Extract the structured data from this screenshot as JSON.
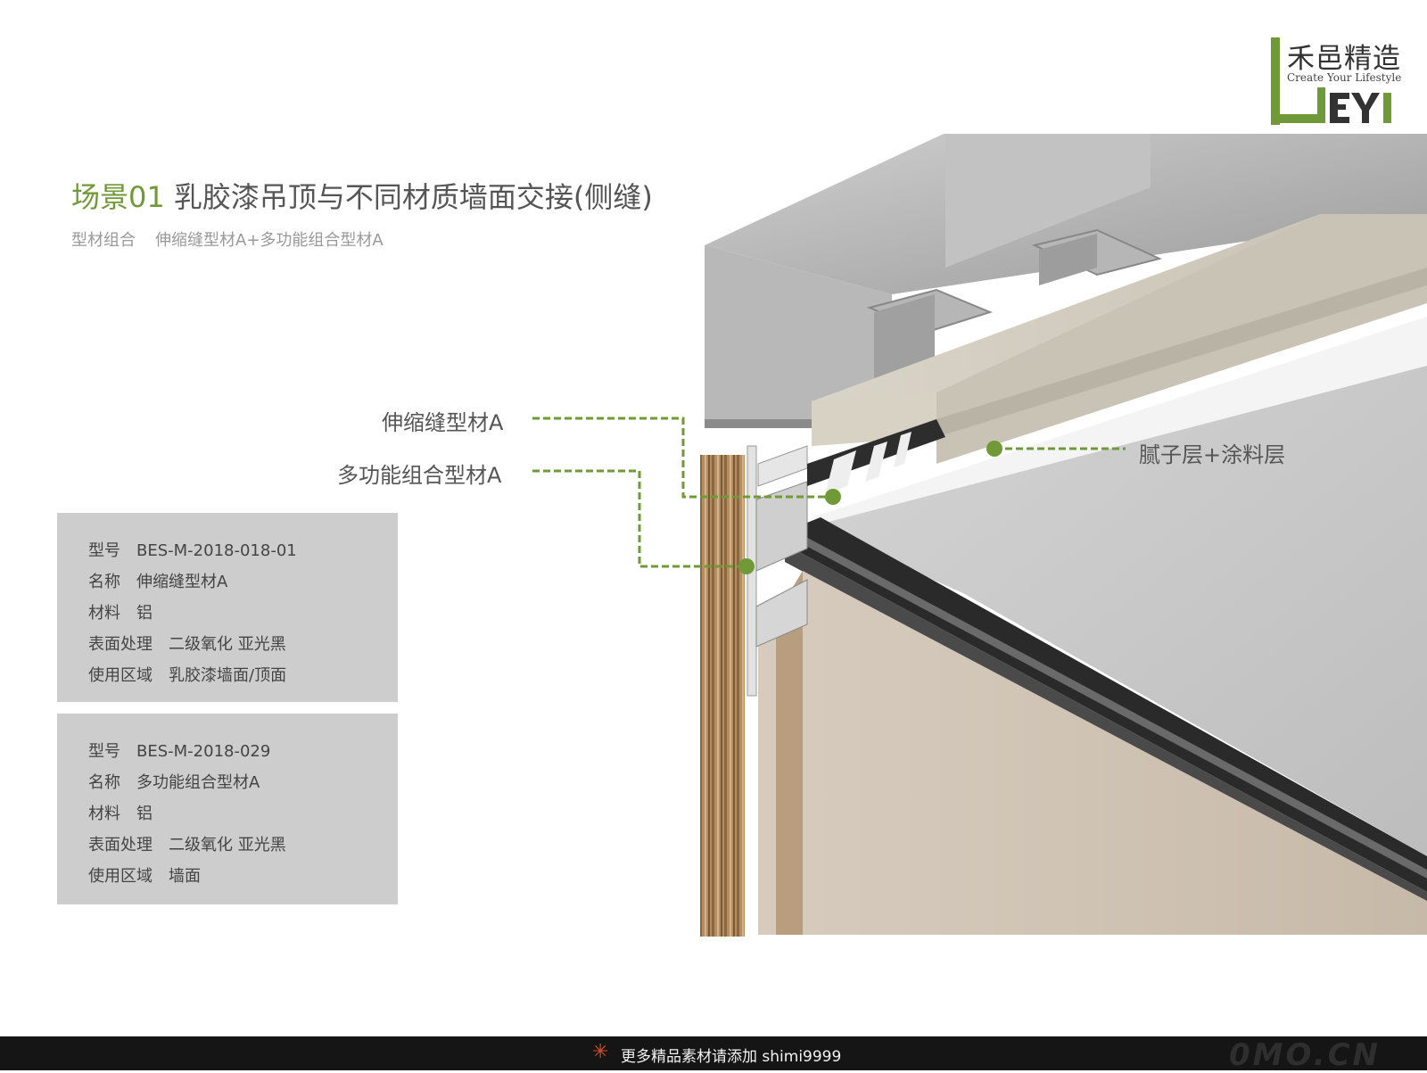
{
  "brand": {
    "name_cn": "禾邑精造",
    "tagline": "Create Your Lifestyle",
    "mark": "HEYI",
    "mark_color": "#6f9a37"
  },
  "title": {
    "scene": "场景01",
    "text": "乳胶漆吊顶与不同材质墙面交接(侧缝)"
  },
  "subtitle": {
    "label": "型材组合",
    "value": "伸缩缝型材A+多功能组合型材A"
  },
  "callouts": [
    {
      "label": "伸缩缝型材A"
    },
    {
      "label": "多功能组合型材A"
    },
    {
      "label": "腻子层+涂料层"
    }
  ],
  "specs": [
    {
      "rows": [
        {
          "key": "型号",
          "value": "BES-M-2018-018-01"
        },
        {
          "key": "名称",
          "value": "伸缩缝型材A"
        },
        {
          "key": "材料",
          "value": "铝"
        },
        {
          "key": "表面处理",
          "value": "二级氧化 亚光黑"
        },
        {
          "key": "使用区域",
          "value": "乳胶漆墙面/顶面"
        }
      ]
    },
    {
      "rows": [
        {
          "key": "型号",
          "value": "BES-M-2018-029"
        },
        {
          "key": "名称",
          "value": "多功能组合型材A"
        },
        {
          "key": "材料",
          "value": "铝"
        },
        {
          "key": "表面处理",
          "value": "二级氧化 亚光黑"
        },
        {
          "key": "使用区域",
          "value": "墙面"
        }
      ]
    }
  ],
  "footer": {
    "text": "更多精品素材请添加 shimi9999",
    "watermark": "0MO.CN"
  },
  "colors": {
    "accent": "#6f9a37",
    "panel": "#cdcdcd",
    "footer_bg": "#151515"
  }
}
